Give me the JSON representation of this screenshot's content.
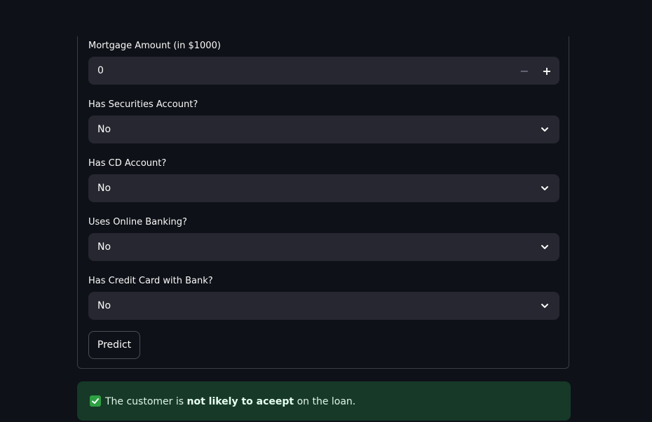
{
  "form": {
    "mortgage": {
      "label": "Mortgage Amount (in $1000)",
      "value": "0",
      "minus_symbol": "−",
      "plus_symbol": "+"
    },
    "securities": {
      "label": "Has Securities Account?",
      "value": "No"
    },
    "cd_account": {
      "label": "Has CD Account?",
      "value": "No"
    },
    "online_banking": {
      "label": "Uses Online Banking?",
      "value": "No"
    },
    "credit_card": {
      "label": "Has Credit Card with Bank?",
      "value": "No"
    },
    "predict_label": "Predict"
  },
  "result": {
    "prefix": "The customer is ",
    "emphasis": "not likely to aceept",
    "suffix": " on the loan.",
    "status_color": "#173928",
    "icon": "check-icon"
  },
  "theme": {
    "background": "#0e1117",
    "input_background": "#262730",
    "text": "#fafafa"
  }
}
